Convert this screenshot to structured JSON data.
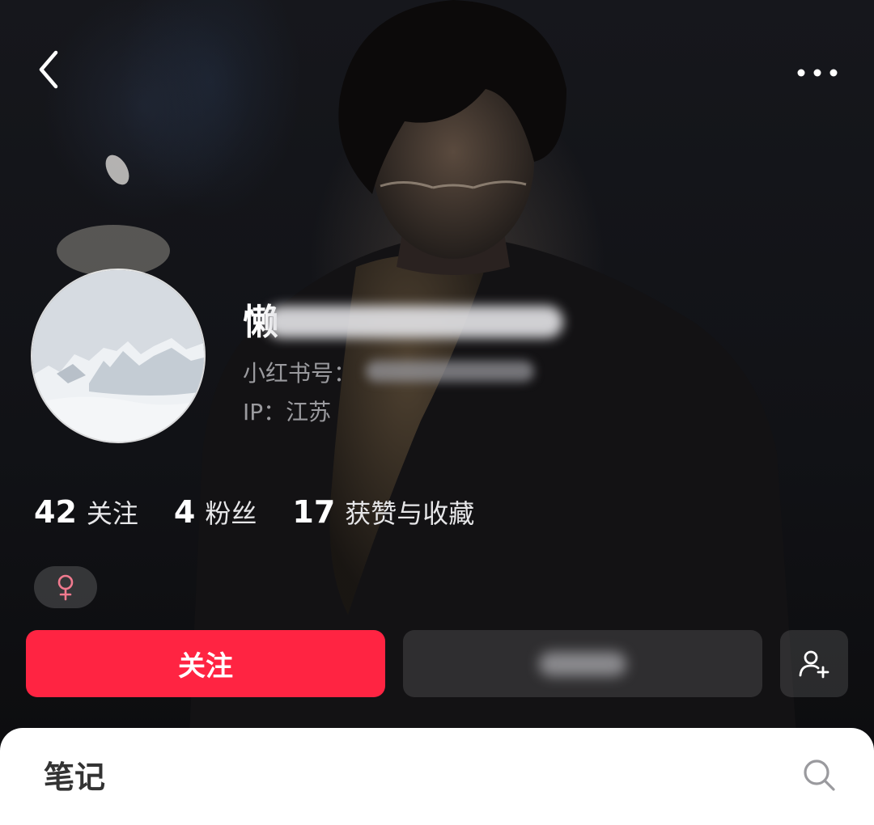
{
  "nav": {
    "back_icon": "chevron-left-icon",
    "more_icon": "more-dots-icon"
  },
  "profile": {
    "nickname": "懒",
    "id_label": "小红书号：",
    "ip_label": "IP：",
    "ip_value": "江苏",
    "avatar_desc": "snowy-mountain-avatar",
    "gender_icon": "female-icon",
    "gender_symbol": "♀"
  },
  "stats": [
    {
      "value": "42",
      "label": "关注"
    },
    {
      "value": "4",
      "label": "粉丝"
    },
    {
      "value": "17",
      "label": "获赞与收藏"
    }
  ],
  "actions": {
    "follow_label": "关注",
    "add_friend_icon": "add-friend-icon"
  },
  "tabs": {
    "notes_label": "笔记",
    "search_icon": "search-icon"
  },
  "colors": {
    "accent": "#ff2442",
    "gender_pink": "#f07a8e",
    "muted_text": "#9a9a9e"
  }
}
